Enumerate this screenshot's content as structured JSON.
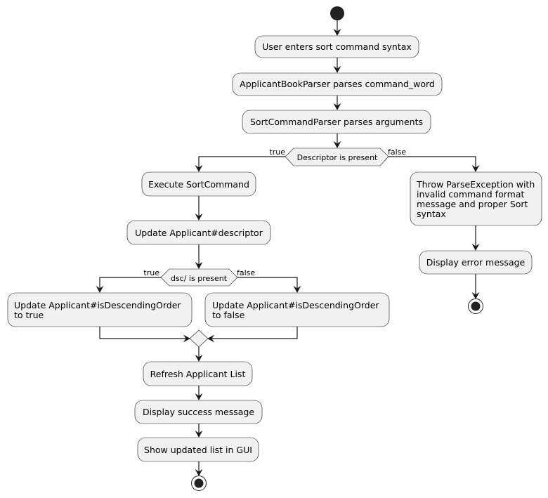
{
  "activities": {
    "user_enters": "User enters sort command syntax",
    "parser_parses": "ApplicantBookParser parses command_word",
    "sort_parser": "SortCommandParser parses arguments",
    "execute": "Execute SortCommand",
    "update_descriptor": "Update Applicant#descriptor",
    "set_true_line1": "Update Applicant#isDescendingOrder",
    "set_true_line2": "to true",
    "set_false_line1": "Update Applicant#isDescendingOrder",
    "set_false_line2": "to false",
    "refresh": "Refresh Applicant List",
    "success": "Display success message",
    "show_list": "Show updated list in GUI",
    "throw_line1": "Throw ParseException with",
    "throw_line2": "invalid command format",
    "throw_line3": "message and proper Sort",
    "throw_line4": "syntax",
    "error": "Display error message"
  },
  "decisions": {
    "descriptor": {
      "condition": "Descriptor is present",
      "true_label": "true",
      "false_label": "false"
    },
    "dsc": {
      "condition": "dsc/ is present",
      "true_label": "true",
      "false_label": "false"
    }
  }
}
